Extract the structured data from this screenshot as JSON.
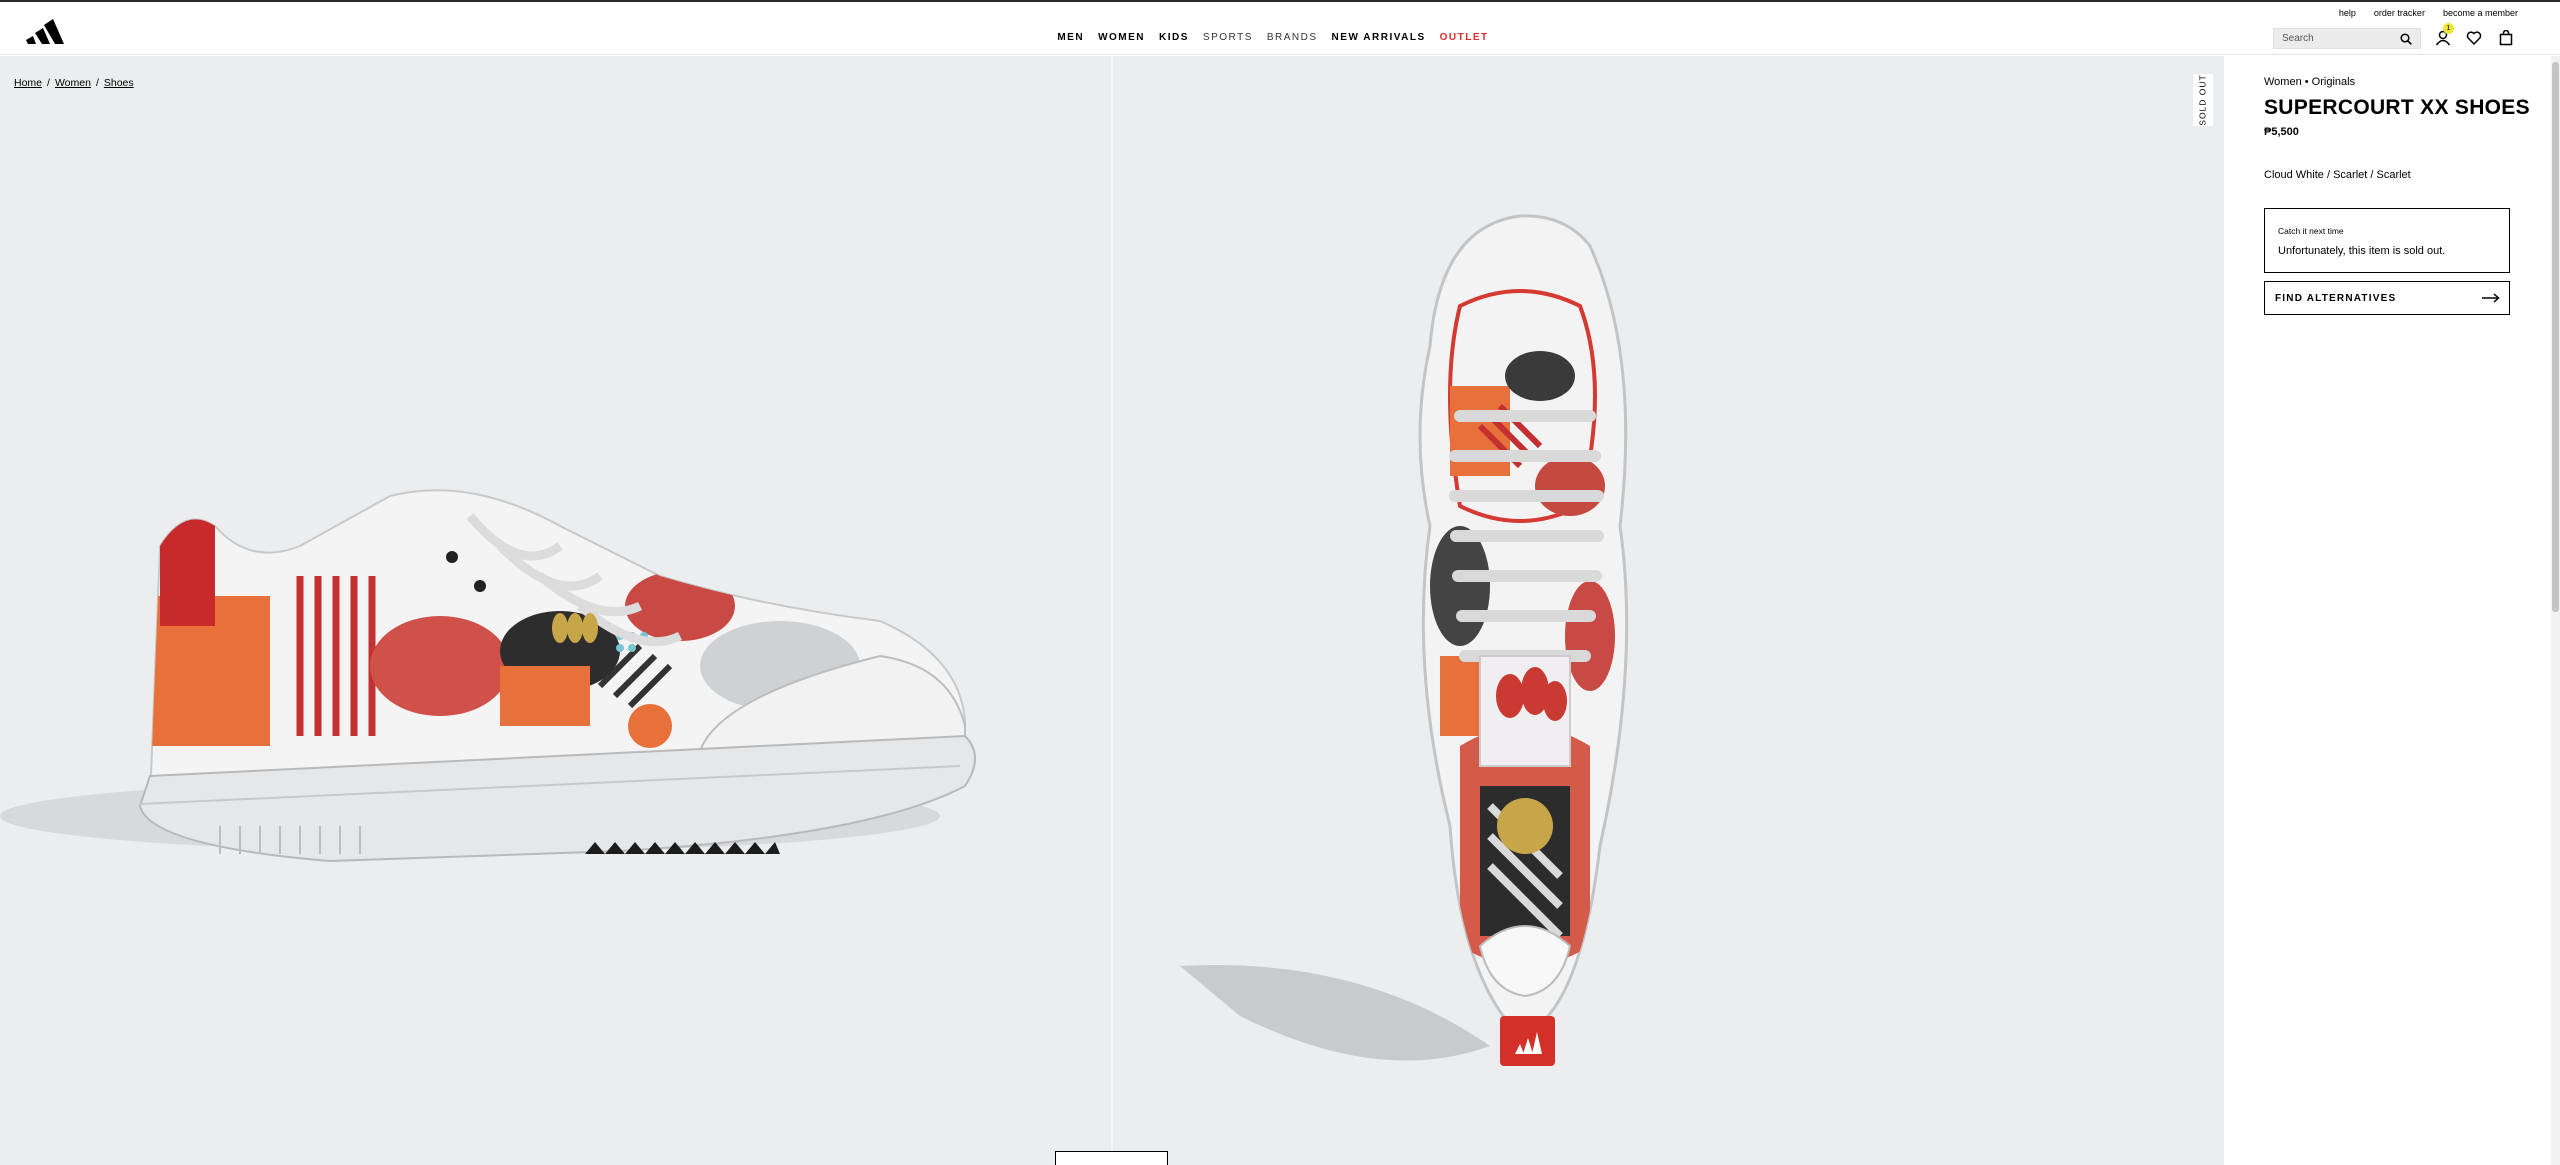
{
  "header": {
    "util_links": [
      "help",
      "order tracker",
      "become a member"
    ],
    "nav": {
      "men": "MEN",
      "women": "WOMEN",
      "kids": "KIDS",
      "sports": "SPORTS",
      "brands": "BRANDS",
      "new_arrivals": "NEW ARRIVALS",
      "outlet": "OUTLET"
    },
    "search_placeholder": "Search",
    "account_badge": "1",
    "outlet_color": "#e32b2b",
    "badge_color": "#ede734"
  },
  "breadcrumb": {
    "home": "Home",
    "sep": "/",
    "women": "Women",
    "shoes": "Shoes"
  },
  "gallery": {
    "sold_out_tag": "SOLD OUT",
    "background": "#ebedee"
  },
  "product": {
    "category": "Women • Originals",
    "title": "SUPERCOURT XX SHOES",
    "price": "₱5,500",
    "color": "Cloud White / Scarlet / Scarlet",
    "sold_box_label": "Catch it next time",
    "sold_box_message": "Unfortunately, this item is sold out.",
    "find_button": "FIND ALTERNATIVES"
  },
  "icons": [
    "adidas-logo-icon",
    "search-icon",
    "account-icon",
    "wishlist-heart-icon",
    "bag-icon",
    "arrow-right-icon"
  ]
}
